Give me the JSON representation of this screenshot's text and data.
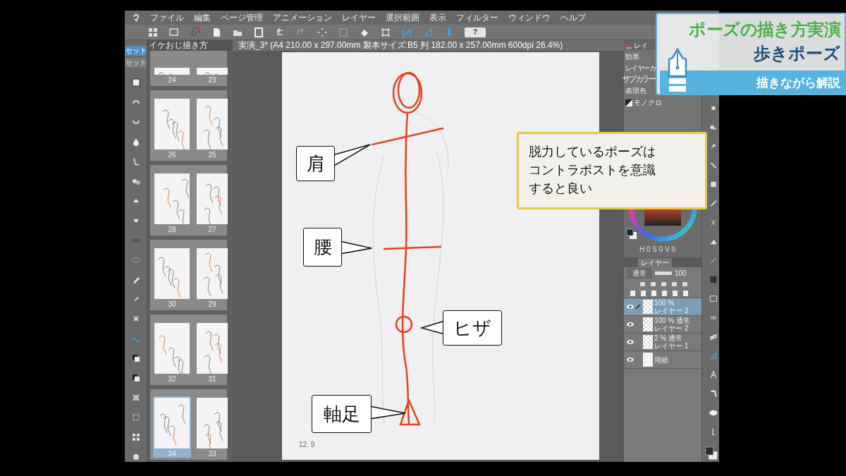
{
  "menu": [
    "ファイル",
    "編集",
    "ページ管理",
    "アニメーション",
    "レイヤー",
    "選択範囲",
    "表示",
    "フィルター",
    "ウィンドウ",
    "ヘルプ"
  ],
  "toolbar": {
    "help": "?"
  },
  "side_sets": [
    {
      "label": "セット",
      "selected": true
    },
    {
      "label": "セット",
      "selected": false
    }
  ],
  "pages_panel": {
    "title": "イケおじ描き方",
    "spreads": [
      {
        "kind": "cut",
        "pages": [
          {
            "number": "24",
            "selected": false
          },
          {
            "number": "23",
            "selected": false
          }
        ]
      },
      {
        "kind": "full",
        "pages": [
          {
            "number": "26",
            "selected": false
          },
          {
            "number": "25",
            "selected": false
          }
        ]
      },
      {
        "kind": "full",
        "pages": [
          {
            "number": "28",
            "selected": false
          },
          {
            "number": "27",
            "selected": false
          }
        ]
      },
      {
        "kind": "full",
        "pages": [
          {
            "number": "30",
            "selected": false
          },
          {
            "number": "29",
            "selected": false
          }
        ]
      },
      {
        "kind": "full",
        "pages": [
          {
            "number": "32",
            "selected": false
          },
          {
            "number": "31",
            "selected": false
          }
        ]
      },
      {
        "kind": "full",
        "pages": [
          {
            "number": "34",
            "selected": true
          },
          {
            "number": "33",
            "selected": false
          }
        ]
      }
    ]
  },
  "canvas": {
    "title": "実演_3* (A4 210.00 x 297.00mm 製本サイズ:B5 判 182.00 x 257.00mm 600dpi 26.4%)",
    "coordinates": "12. 9"
  },
  "callouts": [
    {
      "text": "肩"
    },
    {
      "text": "腰"
    },
    {
      "text": "ヒザ"
    },
    {
      "text": "軸足"
    }
  ],
  "note": {
    "lines": [
      "脱力しているポーズは",
      "コントラポストを意識",
      "すると良い"
    ]
  },
  "property_panel": {
    "tab": "レイ",
    "effect_label": "効果",
    "layer_color": "レイヤーカ",
    "sub_color": "サブカラー",
    "expression_label": "表現色",
    "expression_value": "モノクロ"
  },
  "color_panel": {
    "hsv": "H 0 S 0 V 0"
  },
  "layers_panel": {
    "tab": "レイヤー",
    "blend": "通常",
    "opacity": "100",
    "layers": [
      {
        "kind": "raster",
        "mode": "100 %",
        "name": "レイヤー 3",
        "selected": true,
        "visible": true
      },
      {
        "kind": "raster",
        "mode": "100 % 通常",
        "name": "レイヤー 2",
        "selected": false,
        "visible": true
      },
      {
        "kind": "raster",
        "mode": "2 % 通常",
        "name": "レイヤー 1",
        "selected": false,
        "visible": true
      },
      {
        "kind": "paper",
        "name": "用紙",
        "selected": false,
        "visible": true
      }
    ]
  },
  "banner": {
    "title": "ポーズの描き方実演",
    "subtitle": "歩きポーズ",
    "caption": "描きながら解説"
  }
}
